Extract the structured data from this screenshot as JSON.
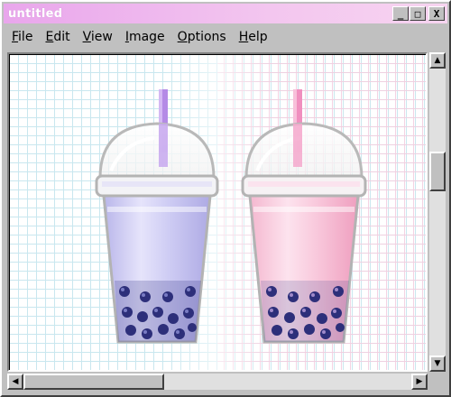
{
  "window": {
    "title": "untitled"
  },
  "title_buttons": [
    {
      "name": "minimize-button",
      "glyph": "_"
    },
    {
      "name": "maximize-button",
      "glyph": "□"
    },
    {
      "name": "close-button",
      "glyph": "X"
    }
  ],
  "menu": [
    {
      "label": "File",
      "key": "F",
      "rest": "ile"
    },
    {
      "label": "Edit",
      "key": "E",
      "rest": "dit"
    },
    {
      "label": "View",
      "key": "V",
      "rest": "iew"
    },
    {
      "label": "Image",
      "key": "I",
      "rest": "mage"
    },
    {
      "label": "Options",
      "key": "O",
      "rest": "ptions"
    },
    {
      "label": "Help",
      "key": "H",
      "rest": "elp"
    }
  ],
  "canvas": {
    "artwork": "bubble-tea-drawing",
    "drinks": [
      {
        "name": "lavender-bubble-tea",
        "tea_color": "#c9c6f0",
        "straw_color": "#b48ae6"
      },
      {
        "name": "pink-bubble-tea",
        "tea_color": "#f8c3d8",
        "straw_color": "#f08fbf"
      }
    ],
    "pearl_color": "#2d2f7a",
    "grid_left_color": "#c9e7ef",
    "grid_right_color": "#f3cfe0"
  },
  "scrollbars": {
    "vertical": {
      "up_glyph": "▲",
      "down_glyph": "▼"
    },
    "horizontal": {
      "left_glyph": "◀",
      "right_glyph": "▶"
    }
  },
  "colors": {
    "chrome": "#c0c0c0",
    "titlebar": "#e9a6ec"
  }
}
